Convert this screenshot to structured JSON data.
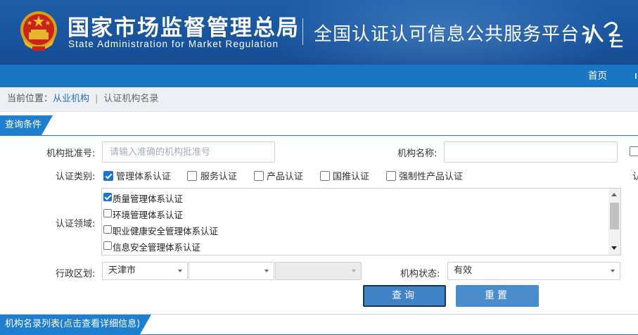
{
  "header": {
    "title_cn": "国家市场监督管理总局",
    "title_en": "State Administration  for  Market Regulation",
    "subtitle": "全国认证认可信息公共服务平台",
    "logo_icon": "renzheng-cloud-logo",
    "emblem_icon": "national-emblem-icon",
    "colors": {
      "banner": "#1a56a0",
      "nav": "#1976c4",
      "accent": "#1e7fd0",
      "button": "#4a8ccc"
    }
  },
  "nav": {
    "home": "首页"
  },
  "breadcrumb": {
    "prefix": "当前位置：",
    "link": "从业机构",
    "separator": "|",
    "current": "认证机构名录"
  },
  "query_section": {
    "title": "查询条件"
  },
  "form": {
    "approval_no_label": "机构批准号:",
    "approval_no_placeholder": "请输入准确的机构批准号",
    "approval_no_value": "",
    "org_name_label": "机构名称:",
    "org_name_value": "",
    "cert_type_label": "认证类别:",
    "cert_types": [
      {
        "label": "管理体系认证",
        "checked": true
      },
      {
        "label": "服务认证",
        "checked": false
      },
      {
        "label": "产品认证",
        "checked": false
      },
      {
        "label": "国推认证",
        "checked": false
      },
      {
        "label": "强制性产品认证",
        "checked": false
      }
    ],
    "domain_label": "认证领域:",
    "domains": [
      {
        "label": "质量管理体系认证",
        "checked": true
      },
      {
        "label": "环境管理体系认证",
        "checked": false
      },
      {
        "label": "职业健康安全管理体系认证",
        "checked": false
      },
      {
        "label": "信息安全管理体系认证",
        "checked": false
      }
    ],
    "region_label": "行政区划:",
    "region_province": "天津市",
    "region_city": "",
    "region_district": "",
    "status_label": "机构状态:",
    "status_value": "有效",
    "query_button": "查询",
    "reset_button": "重置"
  },
  "list_section": {
    "title": "机构名录列表(点击查看详细信息)"
  }
}
